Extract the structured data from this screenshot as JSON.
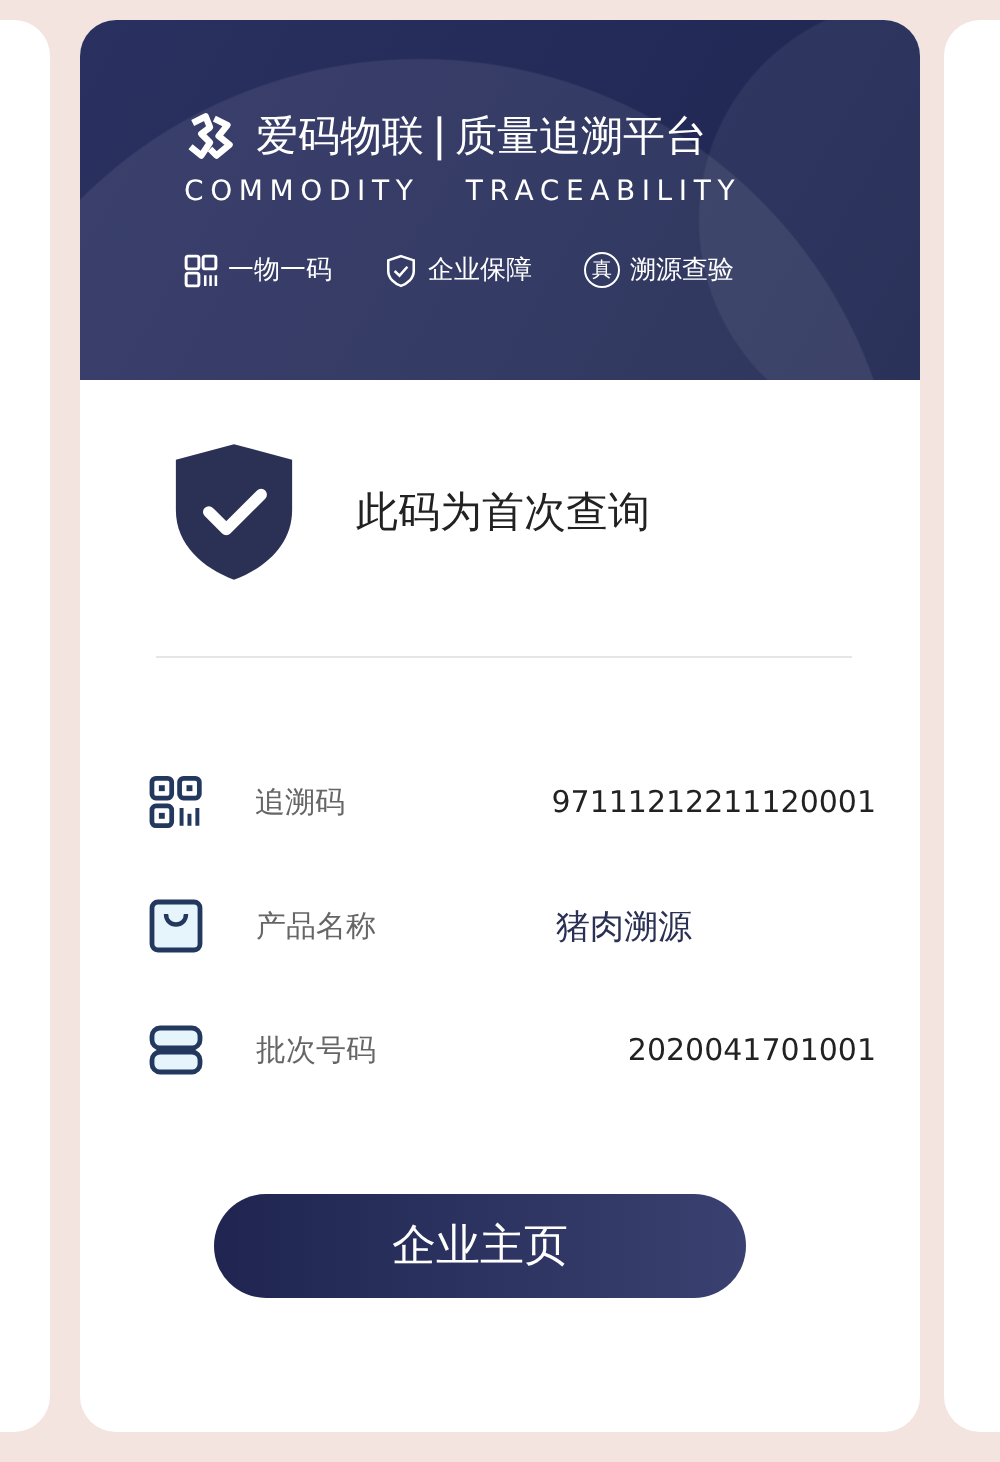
{
  "header": {
    "brand": "爱码物联",
    "divider": "|",
    "title": "质量追溯平台",
    "subtitle": "COMMODITY   TRACEABILITY",
    "features": [
      {
        "kind": "qr",
        "label": "一物一码"
      },
      {
        "kind": "shield",
        "label": "企业保障"
      },
      {
        "kind": "seal",
        "seal_text": "真",
        "label": "溯源查验"
      }
    ]
  },
  "status": {
    "message": "此码为首次查询"
  },
  "details": [
    {
      "kind": "qr",
      "label": "追溯码",
      "value": "97111212211120001"
    },
    {
      "kind": "bag",
      "label": "产品名称",
      "value": "猪肉溯源"
    },
    {
      "kind": "stack",
      "label": "批次号码",
      "value": "2020041701001"
    }
  ],
  "button": "企业主页"
}
